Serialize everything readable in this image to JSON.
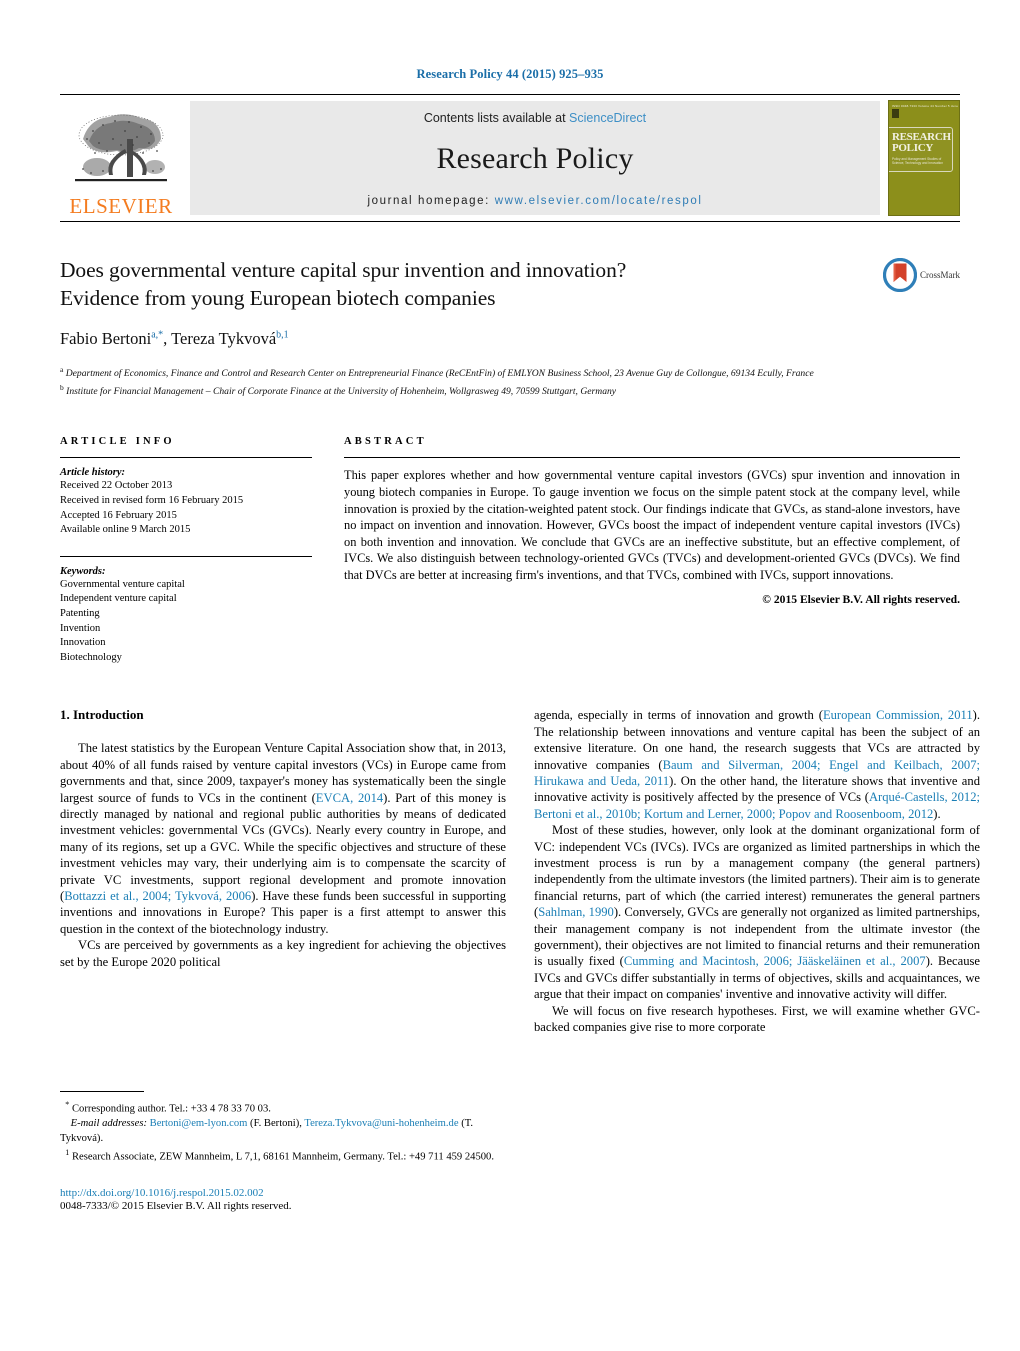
{
  "running_head": "Research Policy 44 (2015) 925–935",
  "masthead": {
    "publisher_name": "ELSEVIER",
    "contents_prefix": "Contents lists available at ",
    "contents_link": "ScienceDirect",
    "journal_title": "Research Policy",
    "homepage_prefix": "journal homepage: ",
    "homepage_url": "www.elsevier.com/locate/respol",
    "cover": {
      "top_text": "ISSN 0048-7333   Volume 44  Number 5  June 2015",
      "title_line1": "RESEARCH",
      "title_line2": "POLICY",
      "subtitle": "Policy and Management Studies of Science, Technology and Innovation"
    }
  },
  "article": {
    "title_line1": "Does governmental venture capital spur invention and innovation?",
    "title_line2": "Evidence from young European biotech companies",
    "authors": [
      {
        "name": "Fabio Bertoni",
        "sup": "a,*"
      },
      {
        "name": "Tereza Tykvová",
        "sup": "b,1"
      }
    ],
    "authors_separator": ", ",
    "affiliations": [
      {
        "marker": "a",
        "text": "Department of Economics, Finance and Control and Research Center on Entrepreneurial Finance (ReCEntFin) of EMLYON Business School, 23 Avenue Guy de Collongue, 69134 Ecully, France"
      },
      {
        "marker": "b",
        "text": "Institute for Financial Management – Chair of Corporate Finance at the University of Hohenheim, Wollgrasweg 49, 70599 Stuttgart, Germany"
      }
    ],
    "crossmark_label": "CrossMark"
  },
  "article_info": {
    "heading": "ARTICLE INFO",
    "history_label": "Article history:",
    "history": [
      "Received 22 October 2013",
      "Received in revised form 16 February 2015",
      "Accepted 16 February 2015",
      "Available online 9 March 2015"
    ],
    "keywords_label": "Keywords:",
    "keywords": [
      "Governmental venture capital",
      "Independent venture capital",
      "Patenting",
      "Invention",
      "Innovation",
      "Biotechnology"
    ]
  },
  "abstract": {
    "heading": "ABSTRACT",
    "text": "This paper explores whether and how governmental venture capital investors (GVCs) spur invention and innovation in young biotech companies in Europe. To gauge invention we focus on the simple patent stock at the company level, while innovation is proxied by the citation-weighted patent stock. Our findings indicate that GVCs, as stand-alone investors, have no impact on invention and innovation. However, GVCs boost the impact of independent venture capital investors (IVCs) on both invention and innovation. We conclude that GVCs are an ineffective substitute, but an effective complement, of IVCs. We also distinguish between technology-oriented GVCs (TVCs) and development-oriented GVCs (DVCs). We find that DVCs are better at increasing firm's inventions, and that TVCs, combined with IVCs, support innovations.",
    "copyright": "© 2015 Elsevier B.V. All rights reserved."
  },
  "introduction": {
    "heading": "1. Introduction",
    "left_paragraphs": [
      "The latest statistics by the European Venture Capital Association show that, in 2013, about 40% of all funds raised by venture capital investors (VCs) in Europe came from governments and that, since 2009, taxpayer's money has systematically been the single largest source of funds to VCs in the continent (EVCA, 2014). Part of this money is directly managed by national and regional public authorities by means of dedicated investment vehicles: governmental VCs (GVCs). Nearly every country in Europe, and many of its regions, set up a GVC. While the specific objectives and structure of these investment vehicles may vary, their underlying aim is to compensate the scarcity of private VC investments, support regional development and promote innovation (Bottazzi et al., 2004; Tykvová, 2006). Have these funds been successful in supporting inventions and innovations in Europe? This paper is a first attempt to answer this question in the context of the biotechnology industry.",
      "VCs are perceived by governments as a key ingredient for achieving the objectives set by the Europe 2020 political"
    ],
    "right_paragraphs": [
      "agenda, especially in terms of innovation and growth (European Commission, 2011). The relationship between innovations and venture capital has been the subject of an extensive literature. On one hand, the research suggests that VCs are attracted by innovative companies (Baum and Silverman, 2004; Engel and Keilbach, 2007; Hirukawa and Ueda, 2011). On the other hand, the literature shows that inventive and innovative activity is positively affected by the presence of VCs (Arqué-Castells, 2012; Bertoni et al., 2010b; Kortum and Lerner, 2000; Popov and Roosenboom, 2012).",
      "Most of these studies, however, only look at the dominant organizational form of VC: independent VCs (IVCs). IVCs are organized as limited partnerships in which the investment process is run by a management company (the general partners) independently from the ultimate investors (the limited partners). Their aim is to generate financial returns, part of which (the carried interest) remunerates the general partners (Sahlman, 1990). Conversely, GVCs are generally not organized as limited partnerships, their management company is not independent from the ultimate investor (the government), their objectives are not limited to financial returns and their remuneration is usually fixed (Cumming and Macintosh, 2006; Jääskeläinen et al., 2007). Because IVCs and GVCs differ substantially in terms of objectives, skills and acquaintances, we argue that their impact on companies' inventive and innovative activity will differ.",
      "We will focus on five research hypotheses. First, we will examine whether GVC-backed companies give rise to more corporate"
    ]
  },
  "footnotes": {
    "corresponding_marker": "*",
    "corresponding_text": "Corresponding author. Tel.: +33 4 78 33 70 03.",
    "email_label": "E-mail addresses:",
    "emails": [
      {
        "address": "Bertoni@em-lyon.com",
        "owner": "(F. Bertoni),"
      },
      {
        "address": "Tereza.Tykvova@uni-hohenheim.de",
        "owner": "(T. Tykvová)."
      }
    ],
    "note1_marker": "1",
    "note1_text": "Research Associate, ZEW Mannheim, L 7,1, 68161 Mannheim, Germany. Tel.: +49 711 459 24500.",
    "doi": "http://dx.doi.org/10.1016/j.respol.2015.02.002",
    "issn": "0048-7333/© 2015 Elsevier B.V. All rights reserved."
  },
  "colors": {
    "link_blue": "#1a7eb5",
    "header_blue": "#1a6ea8",
    "elsevier_orange": "#f47c20",
    "cover_olive": "#8c8f1b",
    "masthead_gray": "#e9e9e9"
  }
}
